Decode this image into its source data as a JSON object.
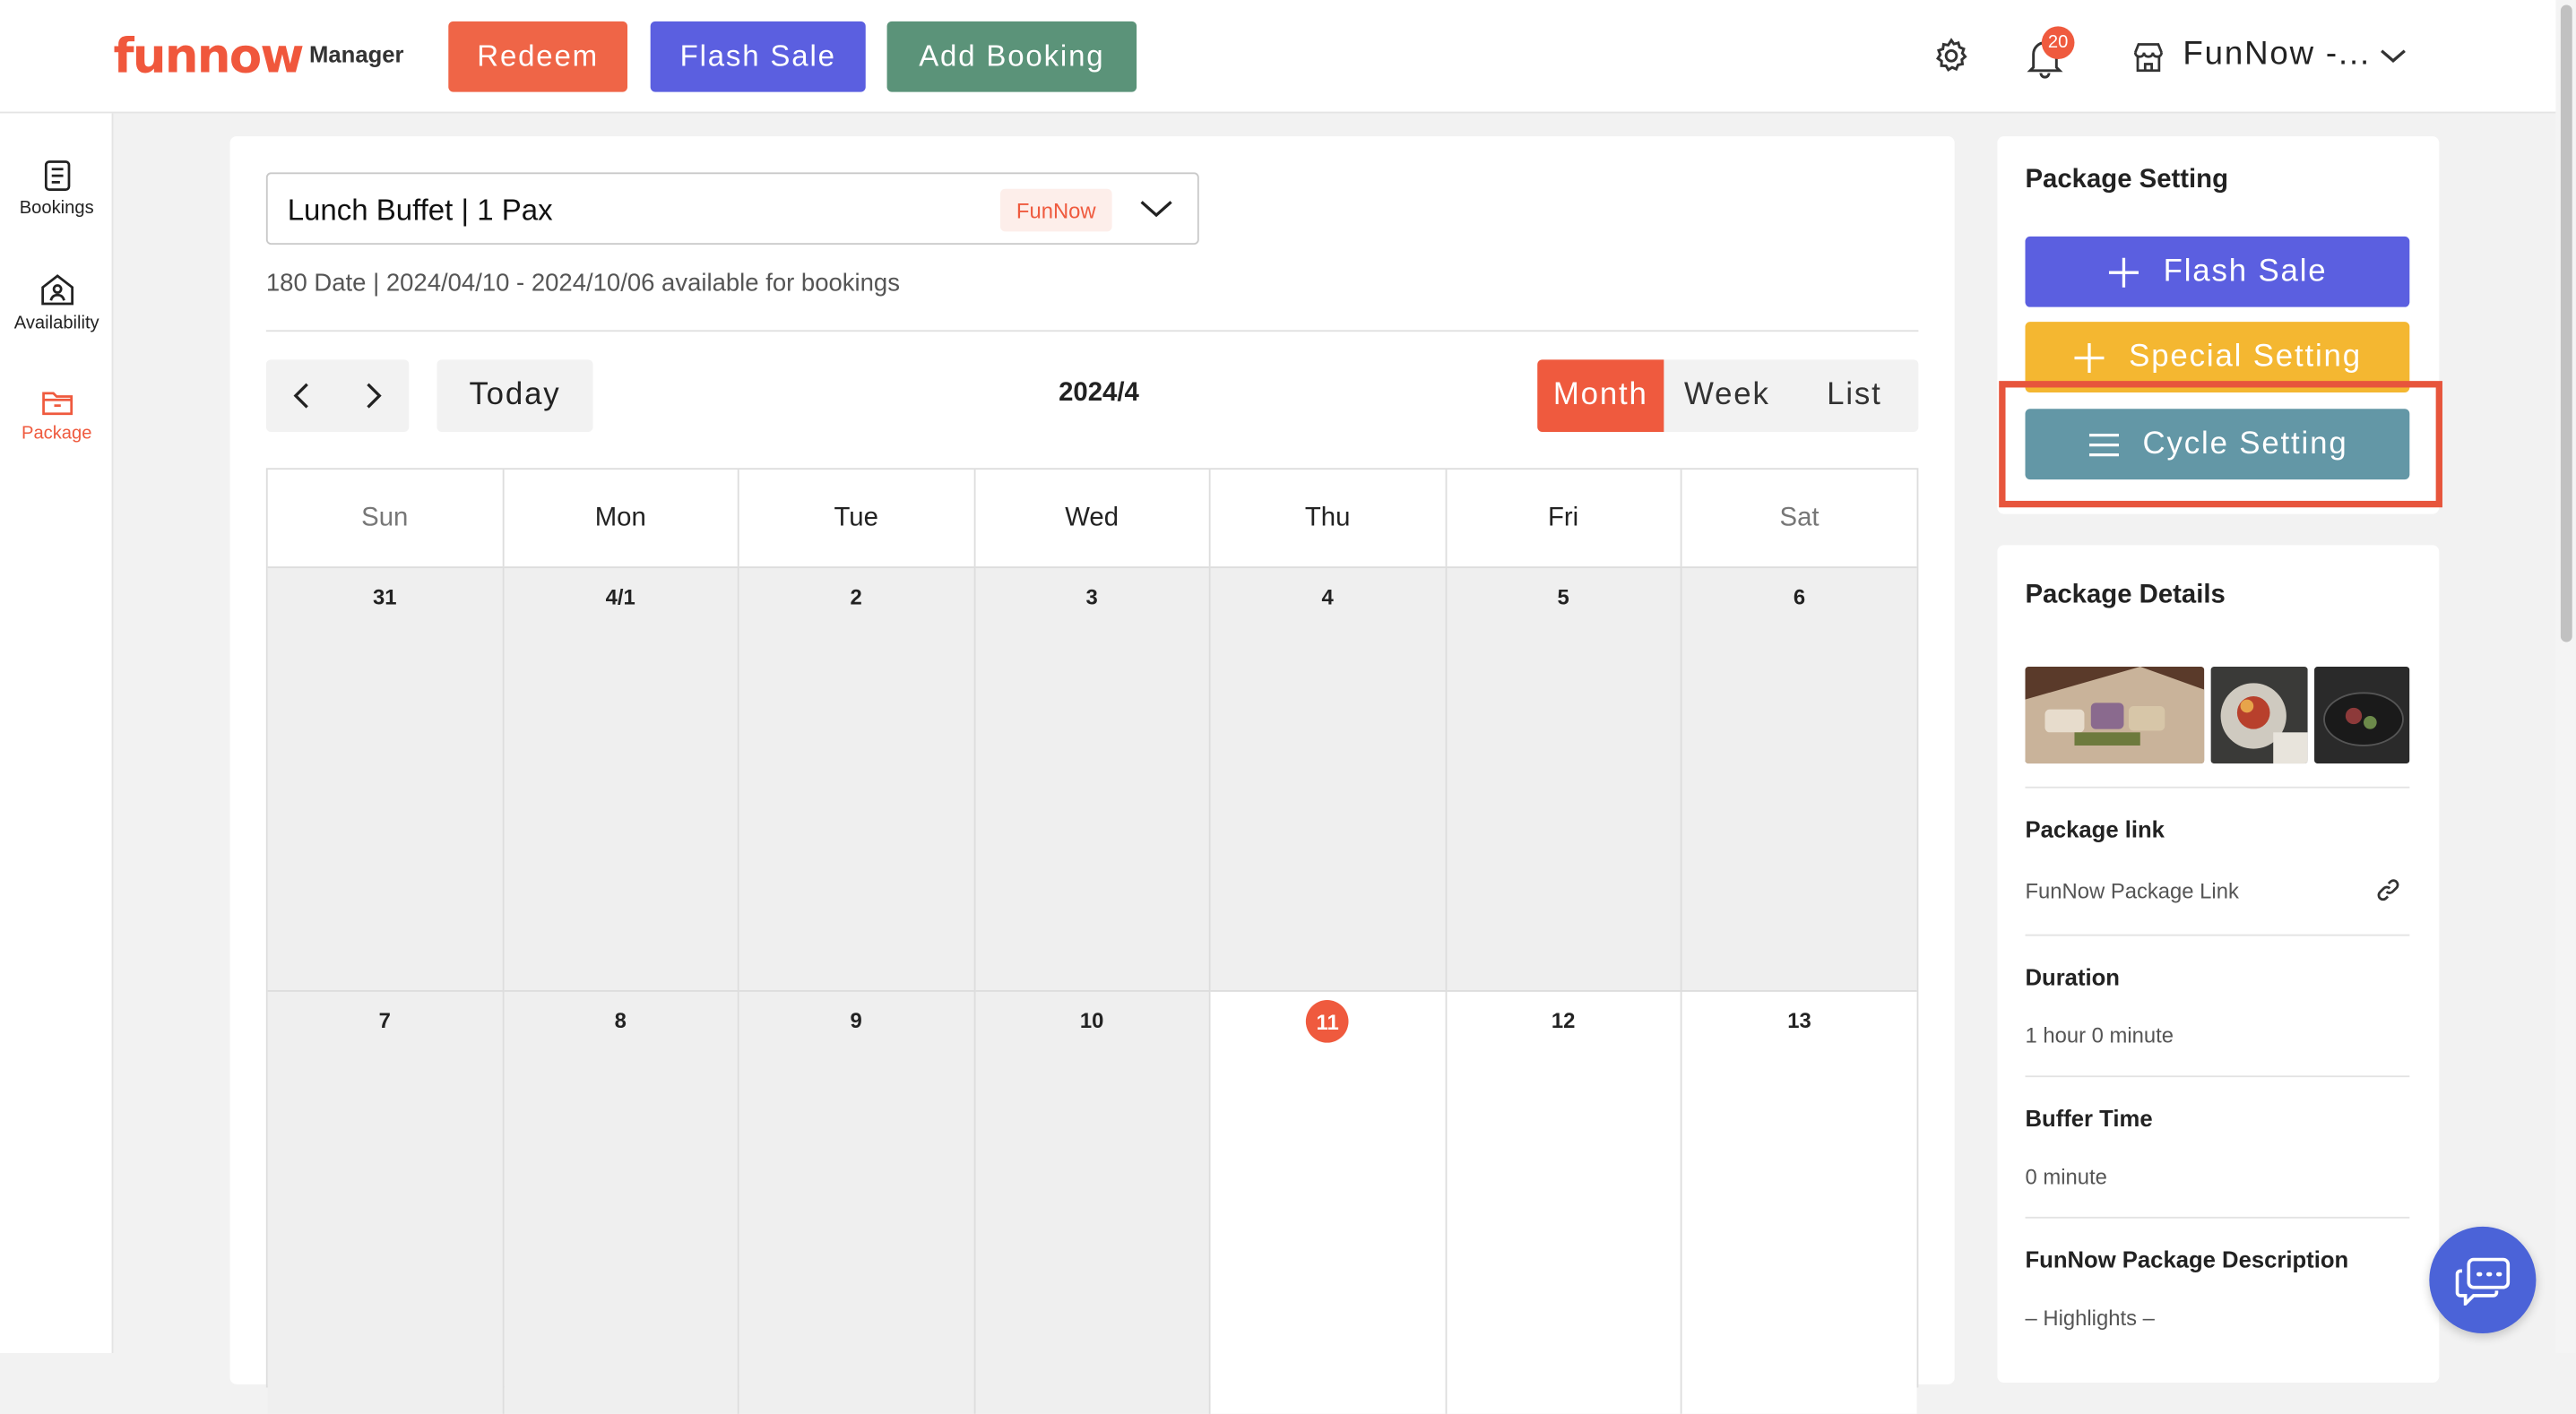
{
  "header": {
    "logo_text": "funnow",
    "logo_sub": "Manager",
    "redeem_label": "Redeem",
    "flash_sale_label": "Flash Sale",
    "add_booking_label": "Add Booking",
    "notification_count": "20",
    "account_name": "FunNow -..."
  },
  "sidebar": {
    "items": [
      {
        "label": "Bookings"
      },
      {
        "label": "Availability"
      },
      {
        "label": "Package"
      }
    ]
  },
  "package_select": {
    "value": "Lunch Buffet | 1 Pax",
    "tag": "FunNow"
  },
  "availability_text": "180 Date | 2024/04/10 - 2024/10/06 available for bookings",
  "calendar": {
    "today_label": "Today",
    "title": "2024/4",
    "views": [
      "Month",
      "Week",
      "List"
    ],
    "active_view": "Month",
    "weekdays": [
      "Sun",
      "Mon",
      "Tue",
      "Wed",
      "Thu",
      "Fri",
      "Sat"
    ],
    "weeks": [
      [
        "31",
        "4/1",
        "2",
        "3",
        "4",
        "5",
        "6"
      ],
      [
        "7",
        "8",
        "9",
        "10",
        "11",
        "12",
        "13"
      ]
    ],
    "today_date": "11"
  },
  "package_setting": {
    "title": "Package Setting",
    "flash_sale_label": "Flash Sale",
    "special_setting_label": "Special Setting",
    "cycle_setting_label": "Cycle Setting"
  },
  "package_details": {
    "title": "Package Details",
    "link_label": "Package link",
    "link_value": "FunNow Package Link",
    "duration_label": "Duration",
    "duration_value": "1 hour 0 minute",
    "buffer_label": "Buffer Time",
    "buffer_value": "0 minute",
    "description_label": "FunNow Package Description",
    "description_value": "– Highlights –"
  },
  "colors": {
    "brand": "#f0573c",
    "flash": "#5b5fe0",
    "add_booking": "#5b9379",
    "special": "#f4b731",
    "cycle": "#6397a6",
    "highlight": "#e7553c"
  }
}
